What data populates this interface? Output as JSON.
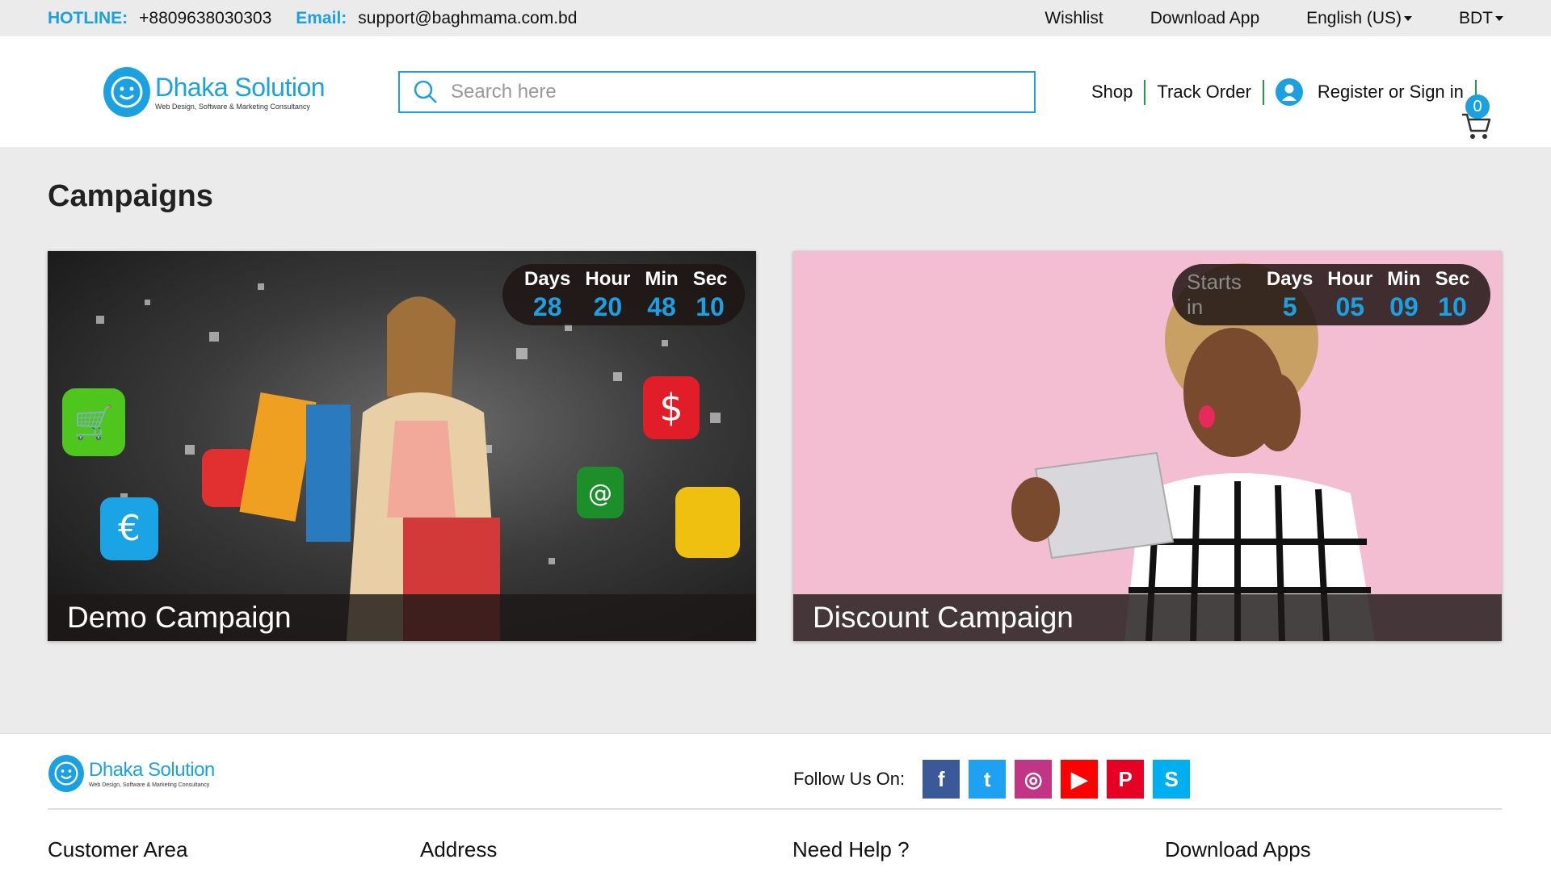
{
  "topbar": {
    "hotline_label": "HOTLINE:",
    "hotline": "+8809638030303",
    "email_label": "Email:",
    "email": "support@baghmama.com.bd",
    "links": [
      "Wishlist",
      "Download App",
      "English (US)",
      "BDT"
    ]
  },
  "header": {
    "logo_title": "Dhaka Solution",
    "logo_subtitle": "Web Design, Software & Marketing Consultancy",
    "search_placeholder": "Search here",
    "nav": {
      "shop": "Shop",
      "track": "Track Order",
      "register": "Register or Sign in"
    },
    "cart_count": "0"
  },
  "main": {
    "title": "Campaigns",
    "campaigns": [
      {
        "name": "Demo Campaign",
        "starts_in": "",
        "timer": {
          "labels": [
            "Days",
            "Hour",
            "Min",
            "Sec"
          ],
          "values": [
            "28",
            "20",
            "48",
            "10"
          ]
        }
      },
      {
        "name": "Discount Campaign",
        "starts_in": "Starts in",
        "timer": {
          "labels": [
            "Days",
            "Hour",
            "Min",
            "Sec"
          ],
          "values": [
            "5",
            "05",
            "09",
            "10"
          ]
        }
      }
    ]
  },
  "footer": {
    "logo_title": "Dhaka Solution",
    "logo_subtitle": "Web Design, Software & Marketing Consultancy",
    "follow_label": "Follow Us On:",
    "social": [
      {
        "name": "facebook",
        "glyph": "f",
        "color": "#3b5998"
      },
      {
        "name": "twitter",
        "glyph": "t",
        "color": "#1da1f2"
      },
      {
        "name": "instagram",
        "glyph": "◎",
        "color": "#c13584"
      },
      {
        "name": "youtube",
        "glyph": "▶",
        "color": "#ff0000"
      },
      {
        "name": "pinterest",
        "glyph": "P",
        "color": "#e60023"
      },
      {
        "name": "skype",
        "glyph": "S",
        "color": "#00aff0"
      }
    ],
    "columns": [
      "Customer Area",
      "Address",
      "Need Help ?",
      "Download Apps"
    ]
  },
  "colors": {
    "accent": "#1ba1e2",
    "divider_green": "#1b9e4b"
  }
}
